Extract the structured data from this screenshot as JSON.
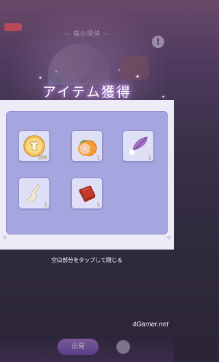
{
  "background": {
    "badge": "",
    "header_title": "—  猫の探偵  —",
    "alert_symbol": "!"
  },
  "reward_popup": {
    "title": "アイテム獲得",
    "items": [
      {
        "name": "shirt-coin",
        "icon": "shirt-coin-icon",
        "quantity": "250"
      },
      {
        "name": "grapefruit",
        "icon": "grapefruit-icon",
        "quantity": "1"
      },
      {
        "name": "feather",
        "icon": "feather-icon",
        "quantity": "1"
      },
      {
        "name": "cloth-piece",
        "icon": "cloth-icon",
        "quantity": "1"
      },
      {
        "name": "red-block",
        "icon": "red-block-icon",
        "quantity": "1"
      }
    ],
    "hint": "空白部分をタップして閉じる"
  },
  "bottom": {
    "go_label": "出発"
  },
  "watermark": "4Gamer.net",
  "colors": {
    "panel": "#ecebf6",
    "inner": "#a5a6df",
    "slot": "#dfe0f7",
    "title_glow": "#c89bff"
  }
}
